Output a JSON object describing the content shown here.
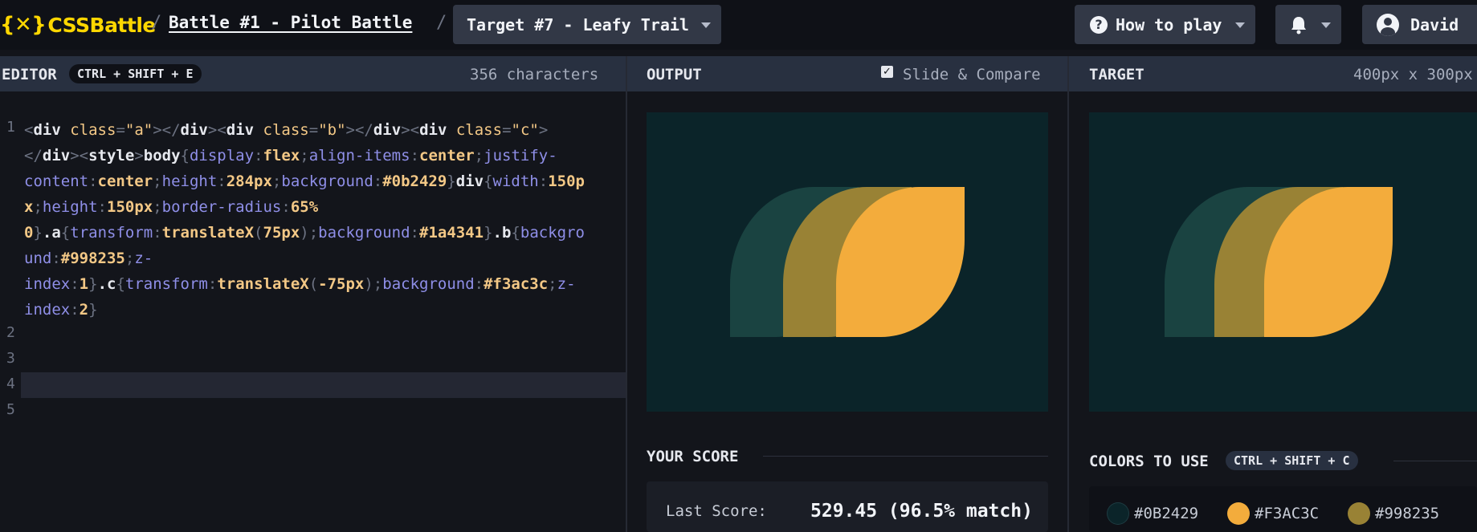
{
  "header": {
    "logo_mark": "{✕}",
    "logo_text": "CSSBattle",
    "sep1": "/",
    "battle": "Battle #1 - Pilot Battle",
    "sep2": "/",
    "target_select": "Target #7 - Leafy Trail",
    "how_to_play": "How to play",
    "user": "David"
  },
  "editor": {
    "title": "EDITOR",
    "shortcut": "CTRL + SHIFT + E",
    "char_count": "356 characters",
    "line_numbers": [
      "1",
      "2",
      "3",
      "4",
      "5"
    ]
  },
  "output": {
    "title": "OUTPUT",
    "slide_compare": "Slide & Compare",
    "slide_compare_checked": true,
    "your_score": "YOUR SCORE",
    "last_score_label": "Last Score:",
    "last_score_value": "529.45 (96.5% match)"
  },
  "target": {
    "title": "TARGET",
    "size": "400px x 300px",
    "colors_title": "COLORS TO USE",
    "colors_shortcut": "CTRL + SHIFT + C",
    "colors": [
      {
        "label": "#0B2429",
        "hex": "#0b2429"
      },
      {
        "label": "#F3AC3C",
        "hex": "#f3ac3c"
      },
      {
        "label": "#998235",
        "hex": "#998235"
      }
    ]
  },
  "art": {
    "background": "#0b2429",
    "a": "#1a4341",
    "b": "#998235",
    "c": "#f3ac3c"
  }
}
